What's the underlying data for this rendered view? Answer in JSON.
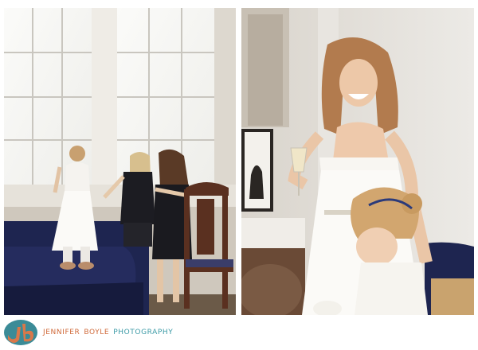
{
  "brand": {
    "first_name": "JENNIFER",
    "last_name": "BOYLE",
    "studio": "PHOTOGRAPHY",
    "logo_letters": "jb",
    "colors": {
      "name": "#d06a3a",
      "studio": "#3b9aa6",
      "logo": "#3b8b97"
    }
  },
  "photos": [
    {
      "icon": "photo-girls-at-window"
    },
    {
      "icon": "photo-laughing-bride"
    }
  ]
}
